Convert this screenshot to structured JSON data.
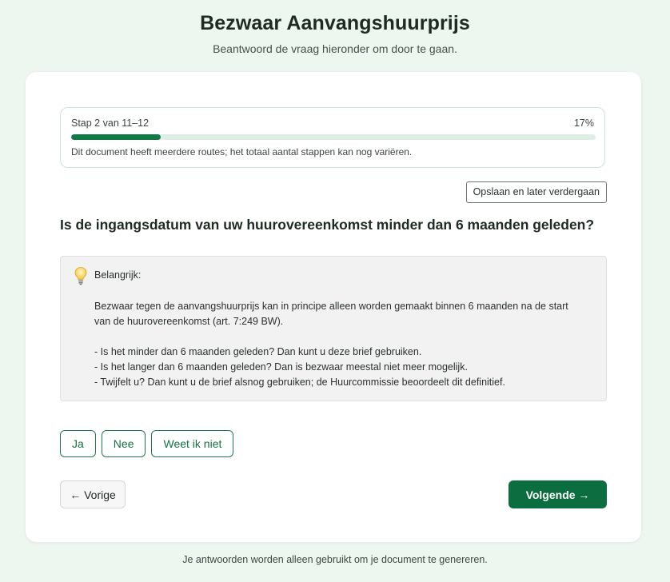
{
  "header": {
    "title": "Bezwaar Aanvangshuurprijs",
    "subtitle": "Beantwoord de vraag hieronder om door te gaan."
  },
  "progress": {
    "step_label": "Stap 2 van 11–12",
    "percent_label": "17%",
    "percent_value": 17,
    "note": "Dit document heeft meerdere routes; het totaal aantal stappen kan nog variëren."
  },
  "save_label": "Opslaan en later verdergaan",
  "question": "Is de ingangsdatum van uw huurovereenkomst minder dan 6 maanden geleden?",
  "info": {
    "icon": "lightbulb-icon",
    "heading": "Belangrijk:",
    "paragraph_line1": "Bezwaar tegen de aanvangshuurprijs kan in principe alleen worden gemaakt binnen 6 maanden na de start",
    "paragraph_line2": "van de huurovereenkomst (art. 7:249 BW).",
    "bullets": [
      "- Is het minder dan 6 maanden geleden? Dan kunt u deze brief gebruiken.",
      "- Is het langer dan 6 maanden geleden? Dan is bezwaar meestal niet meer mogelijk.",
      "- Twijfelt u? Dan kunt u de brief alsnog gebruiken; de Huurcommissie beoordeelt dit definitief."
    ]
  },
  "answers": [
    "Ja",
    "Nee",
    "Weet ik niet"
  ],
  "nav": {
    "prev_label": "← Vorige",
    "next_label": "Volgende →"
  },
  "footer": "Je antwoorden worden alleen gebruikt om je document te genereren.",
  "colors": {
    "accent": "#0c6e40",
    "background": "#eef6f0",
    "progress_track": "#dfeee5",
    "info_background": "#f2f2f2"
  }
}
